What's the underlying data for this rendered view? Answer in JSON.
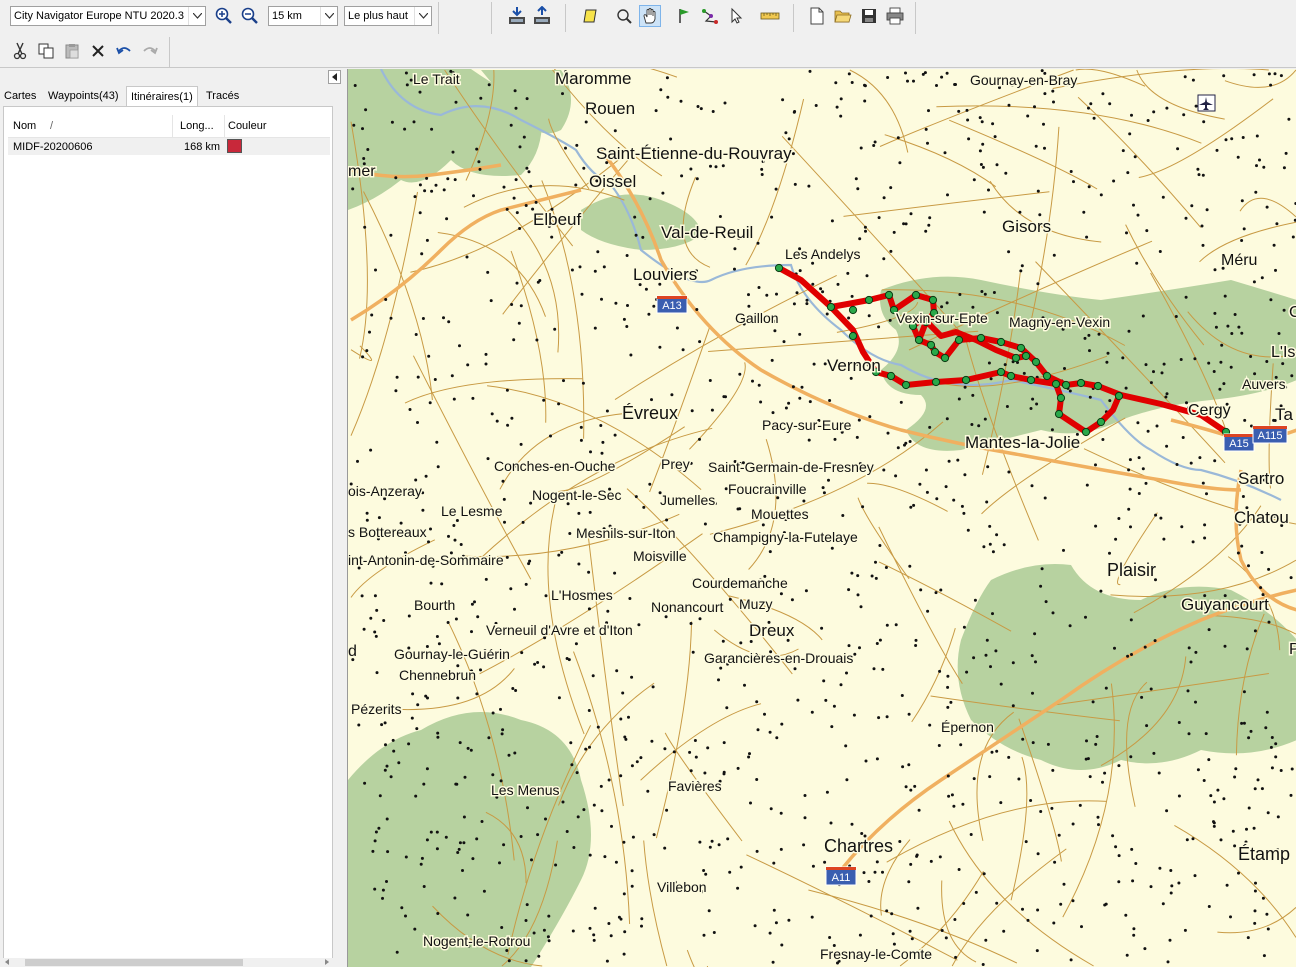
{
  "toolbar": {
    "map_product": "City Navigator Europe NTU 2020.3",
    "zoom_scale": "15 km",
    "detail_level": "Le plus haut"
  },
  "tabs": [
    {
      "label": "Cartes"
    },
    {
      "label": "Waypoints(43)"
    },
    {
      "label": "Itinéraires(1)"
    },
    {
      "label": "Tracés"
    }
  ],
  "route_table": {
    "headers": {
      "name": "Nom",
      "sort": "/",
      "length": "Long...",
      "color": "Couleur"
    },
    "rows": [
      {
        "name": "MIDF-20200606",
        "length": "168 km",
        "color": "#c8283a"
      }
    ]
  },
  "colors": {
    "map_bg": "#fdfbde",
    "forest": "#b7d2a0",
    "route": "#e00000",
    "road": "#c89a44",
    "motorway": "#f0b060",
    "water": "#9ab8d8"
  },
  "map": {
    "shields": [
      "A13",
      "A15",
      "A115",
      "A11"
    ],
    "places": [
      {
        "name": "Le Trait"
      },
      {
        "name": "Maromme"
      },
      {
        "name": "Rouen"
      },
      {
        "name": "Saint-Étienne-du-Rouvray"
      },
      {
        "name": "Oissel"
      },
      {
        "name": "Elbeuf"
      },
      {
        "name": "Val-de-Reuil"
      },
      {
        "name": "Louviers"
      },
      {
        "name": "Les Andelys"
      },
      {
        "name": "Gaillon"
      },
      {
        "name": "Vernon"
      },
      {
        "name": "Gournay-en-Bray"
      },
      {
        "name": "Gisors"
      },
      {
        "name": "Méru"
      },
      {
        "name": "Vexin-sur-Epte"
      },
      {
        "name": "Magny-en-Vexin"
      },
      {
        "name": "L'Is"
      },
      {
        "name": "Auvers"
      },
      {
        "name": "Cergy"
      },
      {
        "name": "Ta"
      },
      {
        "name": "Sartro"
      },
      {
        "name": "Chatou"
      },
      {
        "name": "Mantes-la-Jolie"
      },
      {
        "name": "Pacy-sur-Eure"
      },
      {
        "name": "Évreux"
      },
      {
        "name": "Conches-en-Ouche"
      },
      {
        "name": "Prey"
      },
      {
        "name": "Saint-Germain-de-Fresney"
      },
      {
        "name": "ois-Anzeray"
      },
      {
        "name": "Nogent-le-Sec"
      },
      {
        "name": "Foucrainville"
      },
      {
        "name": "Jumelles"
      },
      {
        "name": "Le Lesme"
      },
      {
        "name": "Mouettes"
      },
      {
        "name": "s Bottereaux"
      },
      {
        "name": "Mesnils-sur-Iton"
      },
      {
        "name": "Champigny-la-Futelaye"
      },
      {
        "name": "int-Antonin-de-Sommaire"
      },
      {
        "name": "Moisville"
      },
      {
        "name": "Courdemanche"
      },
      {
        "name": "Plaisir"
      },
      {
        "name": "L'Hosmes"
      },
      {
        "name": "Bourth"
      },
      {
        "name": "Nonancourt"
      },
      {
        "name": "Muzy"
      },
      {
        "name": "Guyancourt"
      },
      {
        "name": "Verneuil d'Avre et d'Iton"
      },
      {
        "name": "Dreux"
      },
      {
        "name": "Gournay-le-Guérin"
      },
      {
        "name": "Garancières-en-Drouais"
      },
      {
        "name": "Chennebrun"
      },
      {
        "name": "Pézerits"
      },
      {
        "name": "Épernon"
      },
      {
        "name": "Les Menus"
      },
      {
        "name": "Favières"
      },
      {
        "name": "Chartres"
      },
      {
        "name": "Étamp"
      },
      {
        "name": "Villebon"
      },
      {
        "name": "Nogent-le-Rotrou"
      },
      {
        "name": "Fresnay-le-Comte"
      },
      {
        "name": "mer"
      },
      {
        "name": "d"
      },
      {
        "name": "P"
      },
      {
        "name": "C"
      }
    ]
  }
}
